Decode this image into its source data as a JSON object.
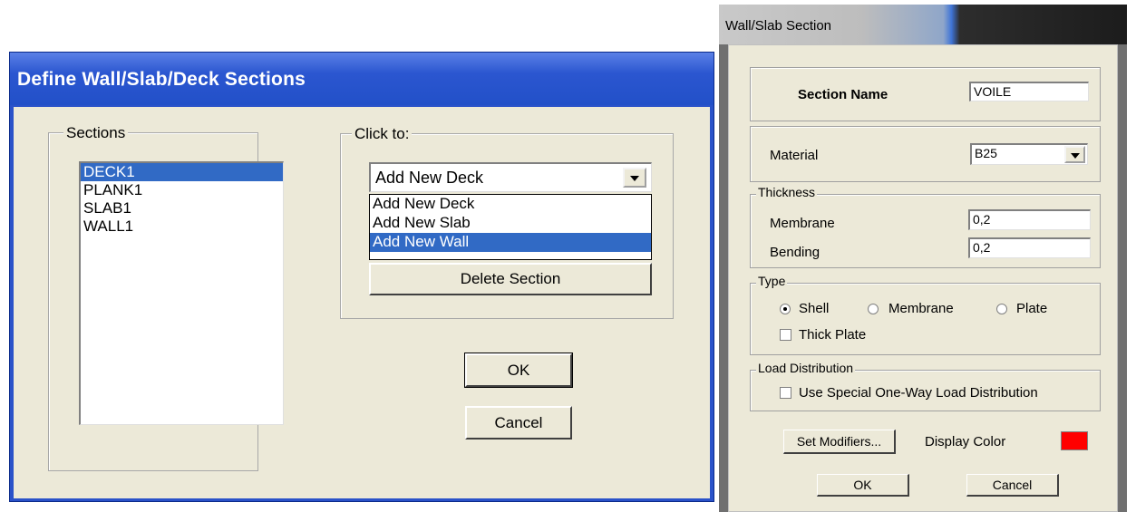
{
  "define_dialog": {
    "title": "Define Wall/Slab/Deck Sections",
    "sections_group_label": "Sections",
    "sections": [
      "DECK1",
      "PLANK1",
      "SLAB1",
      "WALL1"
    ],
    "selected_section": "DECK1",
    "click_group_label": "Click to:",
    "add_combo_value": "Add New Deck",
    "dropdown_options": [
      "Add New Deck",
      "Add New Slab",
      "Add New Wall"
    ],
    "dropdown_highlighted": "Add New Wall",
    "delete_label": "Delete Section",
    "ok_label": "OK",
    "cancel_label": "Cancel"
  },
  "section_dialog": {
    "title": "Wall/Slab Section",
    "section_name_label": "Section Name",
    "section_name_value": "VOILE",
    "material_label": "Material",
    "material_value": "B25",
    "thickness_group": "Thickness",
    "membrane_label": "Membrane",
    "membrane_value": "0,2",
    "bending_label": "Bending",
    "bending_value": "0,2",
    "type_group": "Type",
    "type_options": [
      "Shell",
      "Membrane",
      "Plate"
    ],
    "type_selected": "Shell",
    "thick_plate_label": "Thick Plate",
    "thick_plate_checked": false,
    "load_group": "Load Distribution",
    "one_way_label": "Use Special One-Way Load Distribution",
    "one_way_checked": false,
    "set_modifiers_label": "Set Modifiers...",
    "display_color_label": "Display Color",
    "display_color": "#ff0000",
    "ok_label": "OK",
    "cancel_label": "Cancel"
  }
}
